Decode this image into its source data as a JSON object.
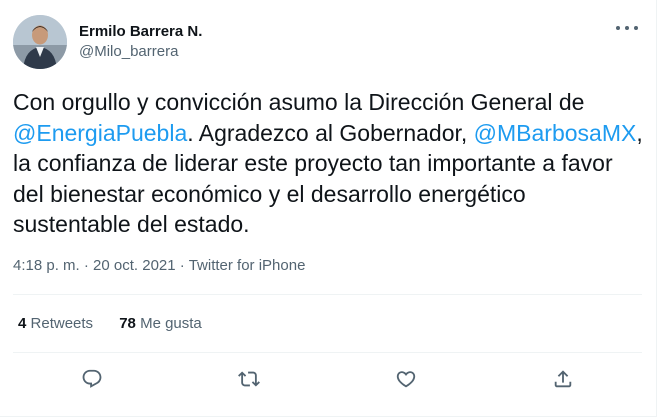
{
  "author": {
    "display_name": "Ermilo Barrera N.",
    "handle": "@Milo_barrera"
  },
  "tweet": {
    "text_1": "Con orgullo y convicción asumo la Dirección General de ",
    "mention_1": "@EnergiaPuebla",
    "text_2": ". Agradezco al Gobernador, ",
    "mention_2": "@MBarbosaMX",
    "text_3": ", la confianza de liderar este proyecto tan importante a favor del bienestar económico y el desarrollo energético sustentable del estado."
  },
  "meta": {
    "time": "4:18 p. m.",
    "sep_1": " · ",
    "date": "20 oct. 2021",
    "sep_2": " · ",
    "source": "Twitter for iPhone"
  },
  "stats": {
    "retweets_count": "4",
    "retweets_label": "Retweets",
    "likes_count": "78",
    "likes_label": "Me gusta"
  },
  "actions": [
    "reply-icon",
    "retweet-icon",
    "like-icon",
    "share-icon"
  ],
  "colors": {
    "link": "#1d9bf0",
    "text": "#0f1419",
    "secondary": "#536471",
    "divider": "#eff3f4"
  }
}
